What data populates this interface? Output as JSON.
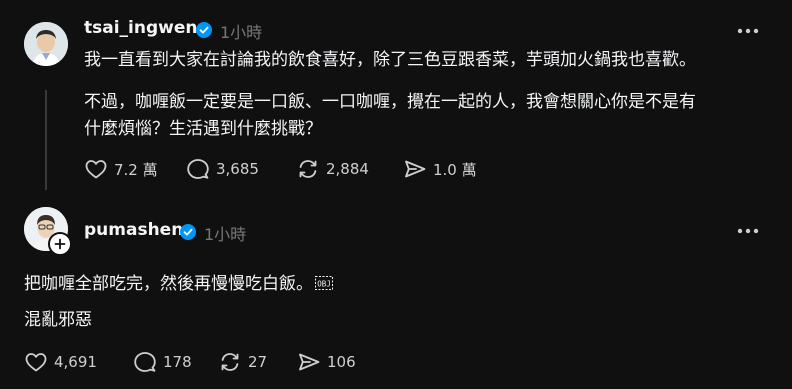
{
  "post": {
    "username": "tsai_ingwen",
    "time": "1小時",
    "paragraph1": "我一直看到大家在討論我的飲食喜好，除了三色豆跟香菜，芋頭加火鍋我也喜歡。",
    "paragraph2_line1": "不過，咖喱飯一定要是一口飯、一口咖喱，攪在一起的人，我會想關心你是不是有",
    "paragraph2_line2": "什麼煩惱？生活遇到什麼挑戰？",
    "likes": "7.2 萬",
    "comments": "3,685",
    "reposts": "2,884",
    "shares": "1.0 萬"
  },
  "reply": {
    "username": "pumashen",
    "time": "1小時",
    "line1": "把咖喱全部吃完，然後再慢慢吃白飯。",
    "line2": "混亂邪惡",
    "likes": "4,691",
    "comments": "178",
    "reposts": "27",
    "shares": "106"
  },
  "colors": {
    "background": "#101010",
    "verified": "#0095f6",
    "text": "#f3f5f7",
    "muted": "#777777"
  },
  "icons": [
    "heart-icon",
    "comment-icon",
    "repost-icon",
    "share-icon",
    "more-icon",
    "verified-icon",
    "follow-plus-icon"
  ]
}
